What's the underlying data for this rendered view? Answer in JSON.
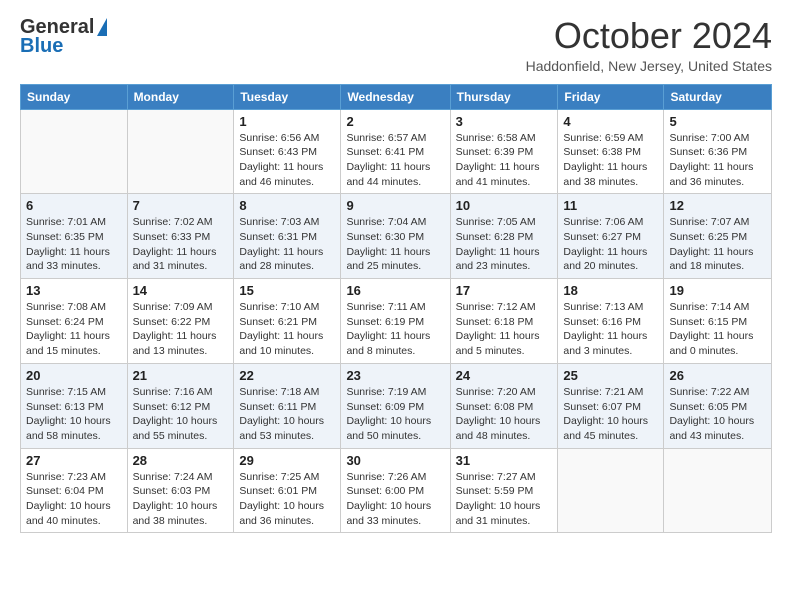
{
  "header": {
    "logo_line1": "General",
    "logo_line2": "Blue",
    "month_year": "October 2024",
    "location": "Haddonfield, New Jersey, United States"
  },
  "days_of_week": [
    "Sunday",
    "Monday",
    "Tuesday",
    "Wednesday",
    "Thursday",
    "Friday",
    "Saturday"
  ],
  "weeks": [
    [
      {
        "day": "",
        "sunrise": "",
        "sunset": "",
        "daylight": ""
      },
      {
        "day": "",
        "sunrise": "",
        "sunset": "",
        "daylight": ""
      },
      {
        "day": "1",
        "sunrise": "Sunrise: 6:56 AM",
        "sunset": "Sunset: 6:43 PM",
        "daylight": "Daylight: 11 hours and 46 minutes."
      },
      {
        "day": "2",
        "sunrise": "Sunrise: 6:57 AM",
        "sunset": "Sunset: 6:41 PM",
        "daylight": "Daylight: 11 hours and 44 minutes."
      },
      {
        "day": "3",
        "sunrise": "Sunrise: 6:58 AM",
        "sunset": "Sunset: 6:39 PM",
        "daylight": "Daylight: 11 hours and 41 minutes."
      },
      {
        "day": "4",
        "sunrise": "Sunrise: 6:59 AM",
        "sunset": "Sunset: 6:38 PM",
        "daylight": "Daylight: 11 hours and 38 minutes."
      },
      {
        "day": "5",
        "sunrise": "Sunrise: 7:00 AM",
        "sunset": "Sunset: 6:36 PM",
        "daylight": "Daylight: 11 hours and 36 minutes."
      }
    ],
    [
      {
        "day": "6",
        "sunrise": "Sunrise: 7:01 AM",
        "sunset": "Sunset: 6:35 PM",
        "daylight": "Daylight: 11 hours and 33 minutes."
      },
      {
        "day": "7",
        "sunrise": "Sunrise: 7:02 AM",
        "sunset": "Sunset: 6:33 PM",
        "daylight": "Daylight: 11 hours and 31 minutes."
      },
      {
        "day": "8",
        "sunrise": "Sunrise: 7:03 AM",
        "sunset": "Sunset: 6:31 PM",
        "daylight": "Daylight: 11 hours and 28 minutes."
      },
      {
        "day": "9",
        "sunrise": "Sunrise: 7:04 AM",
        "sunset": "Sunset: 6:30 PM",
        "daylight": "Daylight: 11 hours and 25 minutes."
      },
      {
        "day": "10",
        "sunrise": "Sunrise: 7:05 AM",
        "sunset": "Sunset: 6:28 PM",
        "daylight": "Daylight: 11 hours and 23 minutes."
      },
      {
        "day": "11",
        "sunrise": "Sunrise: 7:06 AM",
        "sunset": "Sunset: 6:27 PM",
        "daylight": "Daylight: 11 hours and 20 minutes."
      },
      {
        "day": "12",
        "sunrise": "Sunrise: 7:07 AM",
        "sunset": "Sunset: 6:25 PM",
        "daylight": "Daylight: 11 hours and 18 minutes."
      }
    ],
    [
      {
        "day": "13",
        "sunrise": "Sunrise: 7:08 AM",
        "sunset": "Sunset: 6:24 PM",
        "daylight": "Daylight: 11 hours and 15 minutes."
      },
      {
        "day": "14",
        "sunrise": "Sunrise: 7:09 AM",
        "sunset": "Sunset: 6:22 PM",
        "daylight": "Daylight: 11 hours and 13 minutes."
      },
      {
        "day": "15",
        "sunrise": "Sunrise: 7:10 AM",
        "sunset": "Sunset: 6:21 PM",
        "daylight": "Daylight: 11 hours and 10 minutes."
      },
      {
        "day": "16",
        "sunrise": "Sunrise: 7:11 AM",
        "sunset": "Sunset: 6:19 PM",
        "daylight": "Daylight: 11 hours and 8 minutes."
      },
      {
        "day": "17",
        "sunrise": "Sunrise: 7:12 AM",
        "sunset": "Sunset: 6:18 PM",
        "daylight": "Daylight: 11 hours and 5 minutes."
      },
      {
        "day": "18",
        "sunrise": "Sunrise: 7:13 AM",
        "sunset": "Sunset: 6:16 PM",
        "daylight": "Daylight: 11 hours and 3 minutes."
      },
      {
        "day": "19",
        "sunrise": "Sunrise: 7:14 AM",
        "sunset": "Sunset: 6:15 PM",
        "daylight": "Daylight: 11 hours and 0 minutes."
      }
    ],
    [
      {
        "day": "20",
        "sunrise": "Sunrise: 7:15 AM",
        "sunset": "Sunset: 6:13 PM",
        "daylight": "Daylight: 10 hours and 58 minutes."
      },
      {
        "day": "21",
        "sunrise": "Sunrise: 7:16 AM",
        "sunset": "Sunset: 6:12 PM",
        "daylight": "Daylight: 10 hours and 55 minutes."
      },
      {
        "day": "22",
        "sunrise": "Sunrise: 7:18 AM",
        "sunset": "Sunset: 6:11 PM",
        "daylight": "Daylight: 10 hours and 53 minutes."
      },
      {
        "day": "23",
        "sunrise": "Sunrise: 7:19 AM",
        "sunset": "Sunset: 6:09 PM",
        "daylight": "Daylight: 10 hours and 50 minutes."
      },
      {
        "day": "24",
        "sunrise": "Sunrise: 7:20 AM",
        "sunset": "Sunset: 6:08 PM",
        "daylight": "Daylight: 10 hours and 48 minutes."
      },
      {
        "day": "25",
        "sunrise": "Sunrise: 7:21 AM",
        "sunset": "Sunset: 6:07 PM",
        "daylight": "Daylight: 10 hours and 45 minutes."
      },
      {
        "day": "26",
        "sunrise": "Sunrise: 7:22 AM",
        "sunset": "Sunset: 6:05 PM",
        "daylight": "Daylight: 10 hours and 43 minutes."
      }
    ],
    [
      {
        "day": "27",
        "sunrise": "Sunrise: 7:23 AM",
        "sunset": "Sunset: 6:04 PM",
        "daylight": "Daylight: 10 hours and 40 minutes."
      },
      {
        "day": "28",
        "sunrise": "Sunrise: 7:24 AM",
        "sunset": "Sunset: 6:03 PM",
        "daylight": "Daylight: 10 hours and 38 minutes."
      },
      {
        "day": "29",
        "sunrise": "Sunrise: 7:25 AM",
        "sunset": "Sunset: 6:01 PM",
        "daylight": "Daylight: 10 hours and 36 minutes."
      },
      {
        "day": "30",
        "sunrise": "Sunrise: 7:26 AM",
        "sunset": "Sunset: 6:00 PM",
        "daylight": "Daylight: 10 hours and 33 minutes."
      },
      {
        "day": "31",
        "sunrise": "Sunrise: 7:27 AM",
        "sunset": "Sunset: 5:59 PM",
        "daylight": "Daylight: 10 hours and 31 minutes."
      },
      {
        "day": "",
        "sunrise": "",
        "sunset": "",
        "daylight": ""
      },
      {
        "day": "",
        "sunrise": "",
        "sunset": "",
        "daylight": ""
      }
    ]
  ]
}
